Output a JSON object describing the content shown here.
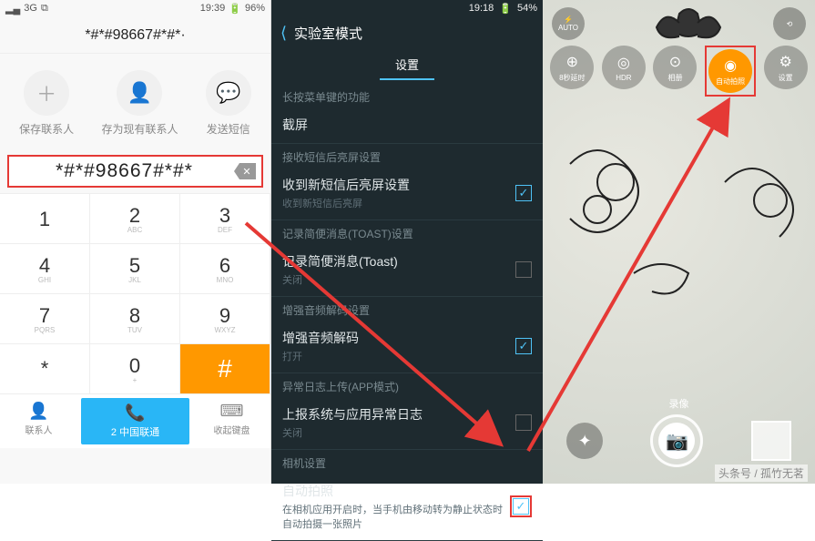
{
  "panel1": {
    "status": {
      "signal": "3G",
      "wifi": "📶",
      "time": "19:39",
      "battery": "96%"
    },
    "title": "*#*#98667#*#*·",
    "actions": [
      {
        "icon": "＋",
        "label": "保存联系人"
      },
      {
        "icon": "👤",
        "label": "存为现有联系人"
      },
      {
        "icon": "💬",
        "label": "发送短信"
      }
    ],
    "highlighted": "*#*#98667#*#*",
    "keys": [
      {
        "n": "1",
        "s": ""
      },
      {
        "n": "2",
        "s": "ABC"
      },
      {
        "n": "3",
        "s": "DEF"
      },
      {
        "n": "4",
        "s": "GHI"
      },
      {
        "n": "5",
        "s": "JKL"
      },
      {
        "n": "6",
        "s": "MNO"
      },
      {
        "n": "7",
        "s": "PQRS"
      },
      {
        "n": "8",
        "s": "TUV"
      },
      {
        "n": "9",
        "s": "WXYZ"
      },
      {
        "n": "*",
        "s": ""
      },
      {
        "n": "0",
        "s": "+"
      },
      {
        "n": "#",
        "s": ""
      }
    ],
    "bottom": {
      "contacts": "联系人",
      "sim_badge": "2",
      "sim": "中国联通",
      "collapse": "收起键盘"
    }
  },
  "panel2": {
    "status": {
      "time": "19:18",
      "battery": "54%"
    },
    "title": "实验室模式",
    "tab": "设置",
    "groups": [
      {
        "header": "长按菜单键的功能",
        "items": [
          {
            "title": "截屏",
            "sub": "",
            "chk": null
          }
        ]
      },
      {
        "header": "接收短信后亮屏设置",
        "items": [
          {
            "title": "收到新短信后亮屏设置",
            "sub": "收到新短信后亮屏",
            "chk": true
          }
        ]
      },
      {
        "header": "记录简便消息(TOAST)设置",
        "items": [
          {
            "title": "记录简便消息(Toast)",
            "sub": "关闭",
            "chk": false
          }
        ]
      },
      {
        "header": "增强音频解码设置",
        "items": [
          {
            "title": "增强音频解码",
            "sub": "打开",
            "chk": true
          }
        ]
      },
      {
        "header": "异常日志上传(APP模式)",
        "items": [
          {
            "title": "上报系统与应用异常日志",
            "sub": "关闭",
            "chk": false
          }
        ]
      },
      {
        "header": "相机设置",
        "items": [
          {
            "title": "自动拍照",
            "sub": "在相机应用开启时，当手机由移动转为静止状态时自动拍摄一张照片",
            "chk": true,
            "highlight": true
          }
        ]
      }
    ]
  },
  "panel3": {
    "top": [
      {
        "icon": "⚡",
        "label": "AUTO"
      },
      {
        "icon": "⟲",
        "label": ""
      }
    ],
    "icons": [
      {
        "sym": "⊕",
        "label": "8秒延时"
      },
      {
        "sym": "◎",
        "label": "HDR"
      },
      {
        "sym": "⊙",
        "label": "相册"
      },
      {
        "sym": "◉",
        "label": "自动拍照",
        "active": true,
        "highlight": true
      },
      {
        "sym": "⚙",
        "label": "设置"
      }
    ],
    "rec": "录像",
    "footer": "头条号 / 孤竹无茗"
  }
}
